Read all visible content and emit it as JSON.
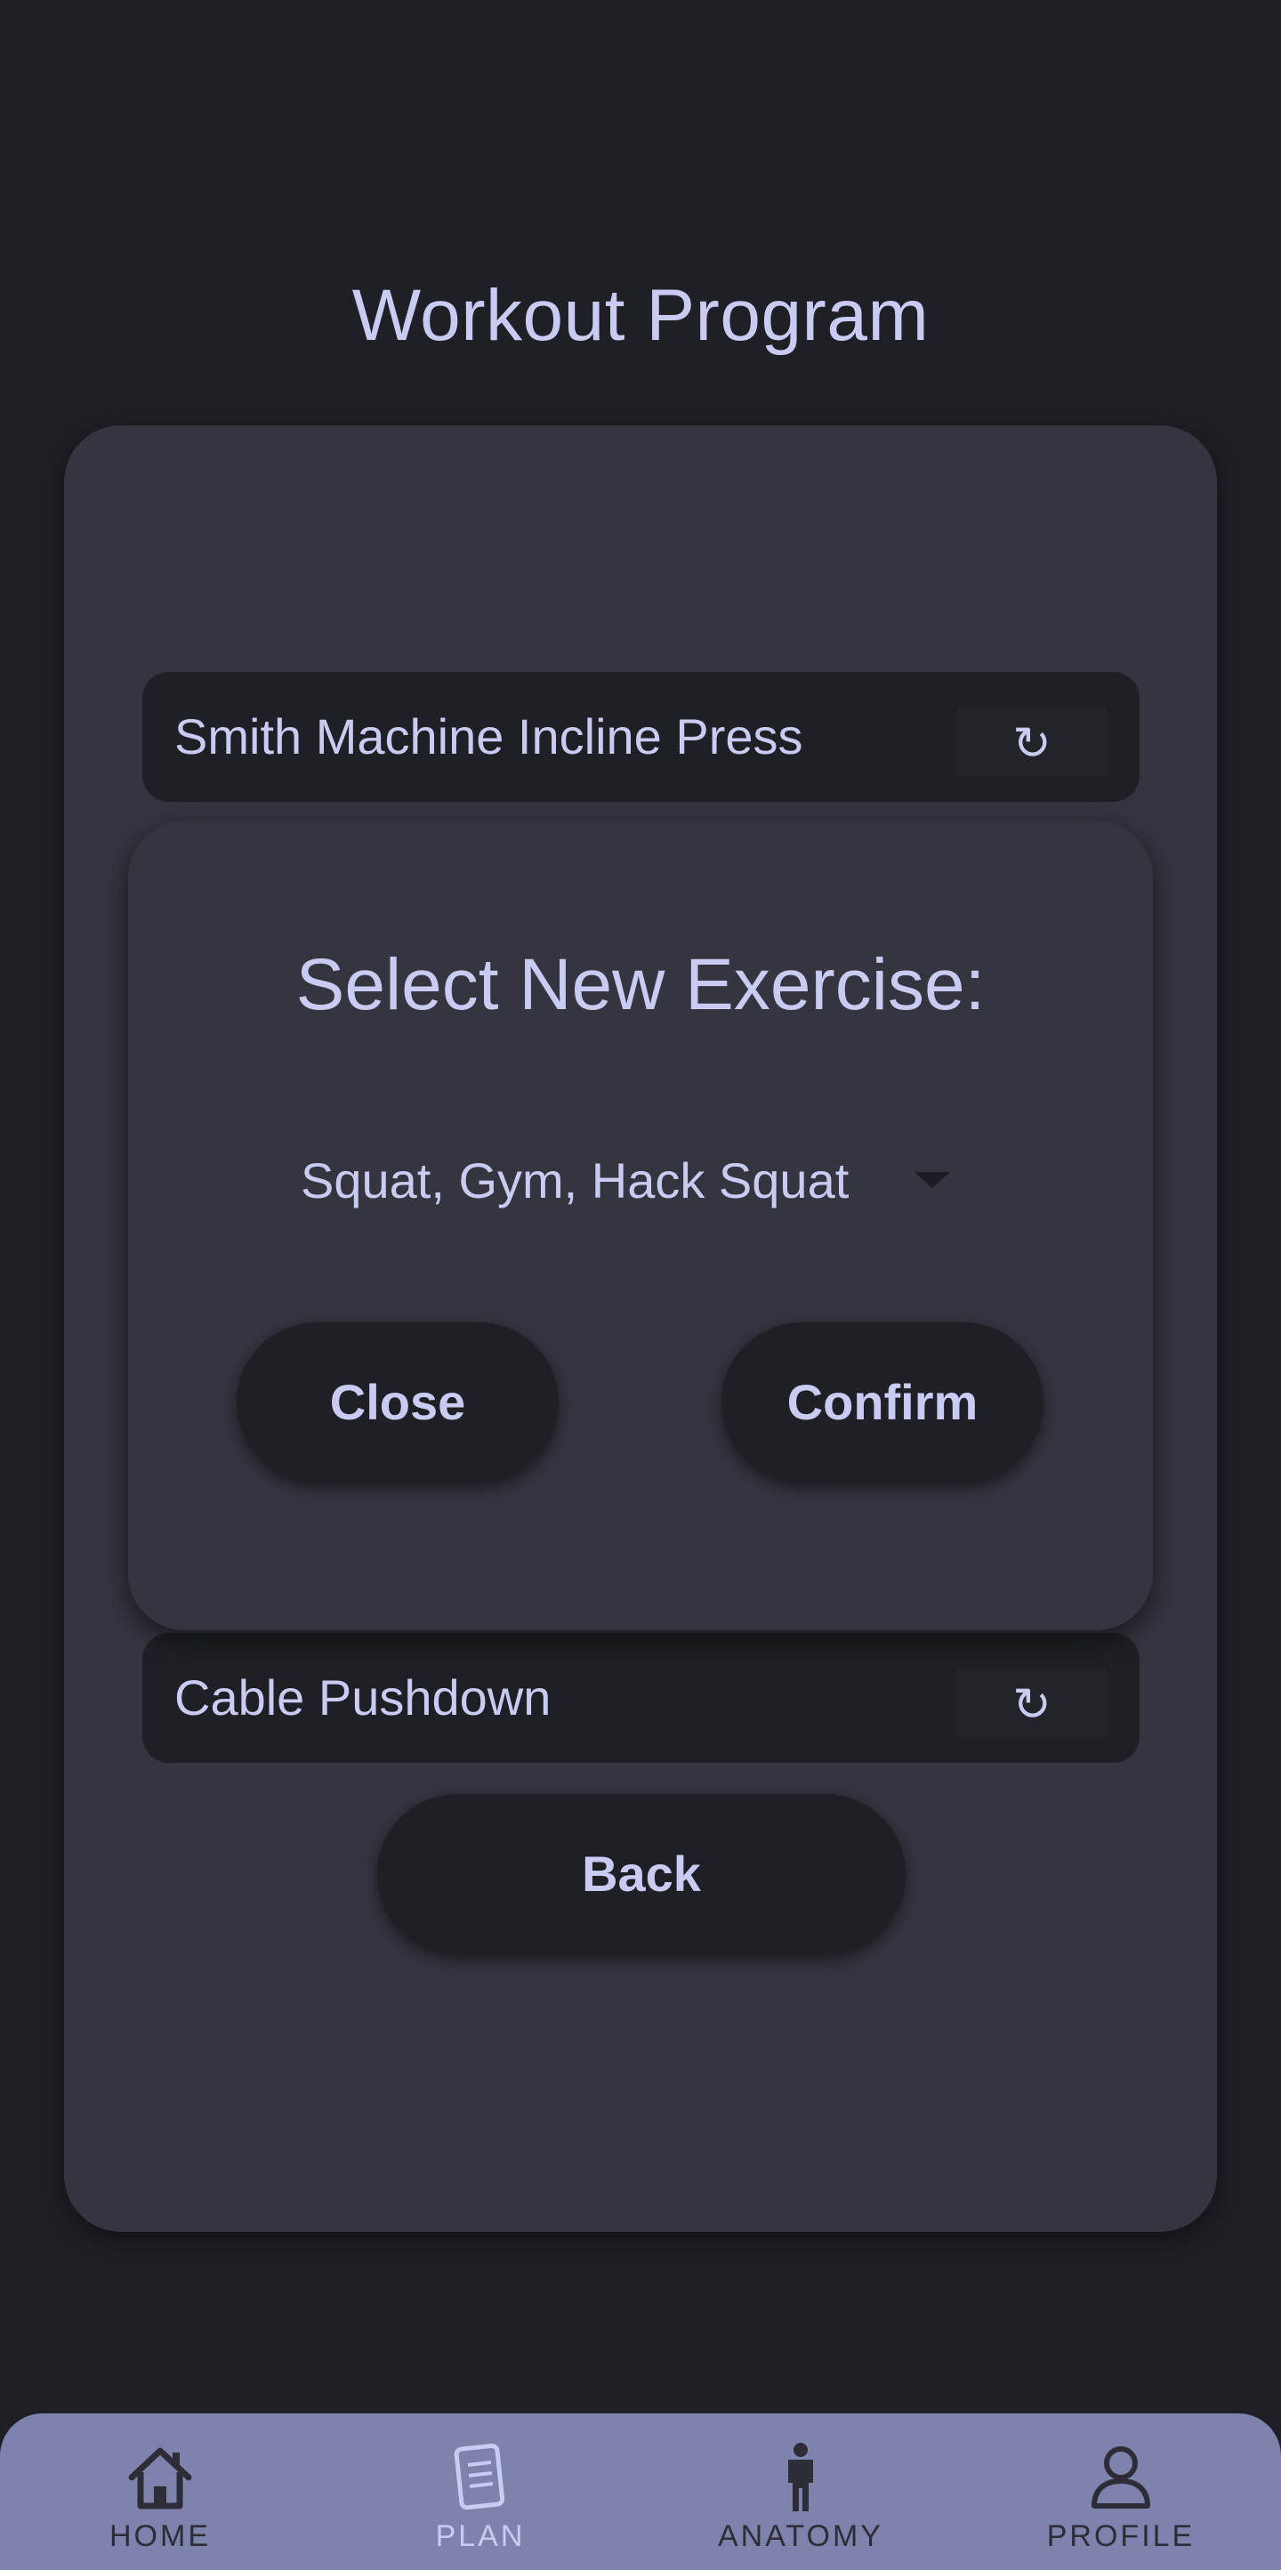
{
  "page": {
    "title": "Workout Program"
  },
  "exercises": [
    {
      "name": "Smith Machine Incline Press",
      "swap_icon": "↻"
    },
    {
      "name": "Cable Pushdown",
      "swap_icon": "↻"
    }
  ],
  "modal": {
    "title": "Select New Exercise:",
    "dropdown_value": "Squat, Gym, Hack Squat",
    "close_label": "Close",
    "confirm_label": "Confirm"
  },
  "back_label": "Back",
  "nav": {
    "items": [
      {
        "label": "HOME",
        "icon": "home-icon",
        "active": false
      },
      {
        "label": "PLAN",
        "icon": "plan-icon",
        "active": true
      },
      {
        "label": "ANATOMY",
        "icon": "anatomy-icon",
        "active": false
      },
      {
        "label": "PROFILE",
        "icon": "profile-icon",
        "active": false
      }
    ]
  },
  "colors": {
    "background": "#1f2025",
    "card": "#34353f",
    "text": "#c9cbf2",
    "navbar": "#7d83ac"
  }
}
